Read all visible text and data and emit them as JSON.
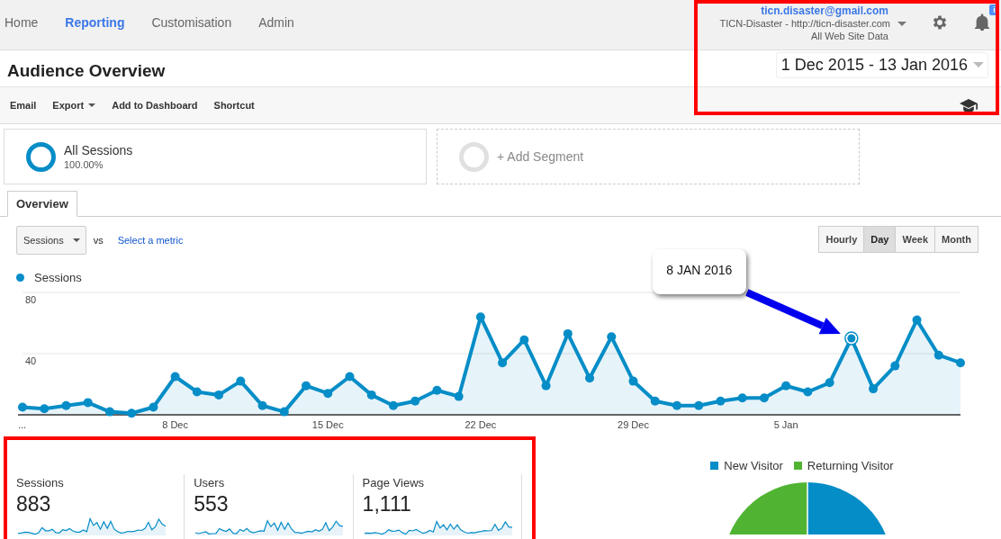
{
  "nav": {
    "tabs": [
      {
        "label": "Home",
        "selected": false
      },
      {
        "label": "Reporting",
        "selected": true
      },
      {
        "label": "Customisation",
        "selected": false
      },
      {
        "label": "Admin",
        "selected": false
      }
    ]
  },
  "account": {
    "email": "ticn.disaster@gmail.com",
    "property": "TICN-Disaster - http://ticn-disaster.com",
    "view": "All Web Site Data",
    "notification_badge": "i",
    "highlighted": true
  },
  "page": {
    "title": "Audience Overview",
    "date_range": "1 Dec 2015 - 13 Jan 2016"
  },
  "toolbar": [
    {
      "label": "Email",
      "kind": "link"
    },
    {
      "label": "Export",
      "kind": "menu"
    },
    {
      "label": "Add to Dashboard",
      "kind": "link"
    },
    {
      "label": "Shortcut",
      "kind": "link"
    }
  ],
  "segments": [
    {
      "kind": "segment",
      "name": "All Sessions",
      "share": "100.00%"
    },
    {
      "kind": "add",
      "name": "+ Add Segment"
    }
  ],
  "tabs": [
    {
      "label": "Overview",
      "selected": true
    }
  ],
  "metric_picker": {
    "value": "Sessions",
    "vs": "vs",
    "link": "Select a metric"
  },
  "granularity": [
    {
      "label": "Hourly",
      "selected": false
    },
    {
      "label": "Day",
      "selected": true
    },
    {
      "label": "Week",
      "selected": false
    },
    {
      "label": "Month",
      "selected": false
    }
  ],
  "chart": {
    "chart_data": {
      "type": "area",
      "categories": [
        "...",
        null,
        null,
        null,
        null,
        null,
        null,
        "8 Dec",
        null,
        null,
        null,
        null,
        null,
        null,
        "15 Dec",
        null,
        null,
        null,
        null,
        null,
        null,
        "22 Dec",
        null,
        null,
        null,
        null,
        null,
        null,
        "29 Dec",
        null,
        null,
        null,
        null,
        null,
        null,
        "5 Jan",
        null,
        null,
        null,
        null,
        null,
        null,
        null,
        null
      ],
      "series": [
        {
          "name": "Sessions",
          "color": "#058dc7",
          "values": [
            5,
            4,
            6,
            8,
            2,
            1,
            5,
            25,
            15,
            13,
            22,
            6,
            2,
            19,
            14,
            25,
            13,
            6,
            9,
            16,
            12,
            64,
            34,
            49,
            19,
            53,
            24,
            51,
            22,
            9,
            6,
            6,
            9,
            11,
            11,
            19,
            15,
            21,
            50,
            17,
            32,
            62,
            39,
            34
          ]
        }
      ],
      "ylim": [
        0,
        80
      ],
      "yticks": [
        40,
        80
      ]
    },
    "callout": {
      "text": "8 JAN 2016"
    }
  },
  "metrics": {
    "highlighted": true,
    "items": [
      {
        "label": "Sessions",
        "value": "883"
      },
      {
        "label": "Users",
        "value": "553"
      },
      {
        "label": "Page Views",
        "value": "1,111"
      }
    ]
  },
  "visitor_pie": {
    "legend": [
      {
        "label": "New Visitor",
        "color": "#058dc7"
      },
      {
        "label": "Returning Visitor",
        "color": "#50b432"
      }
    ]
  }
}
